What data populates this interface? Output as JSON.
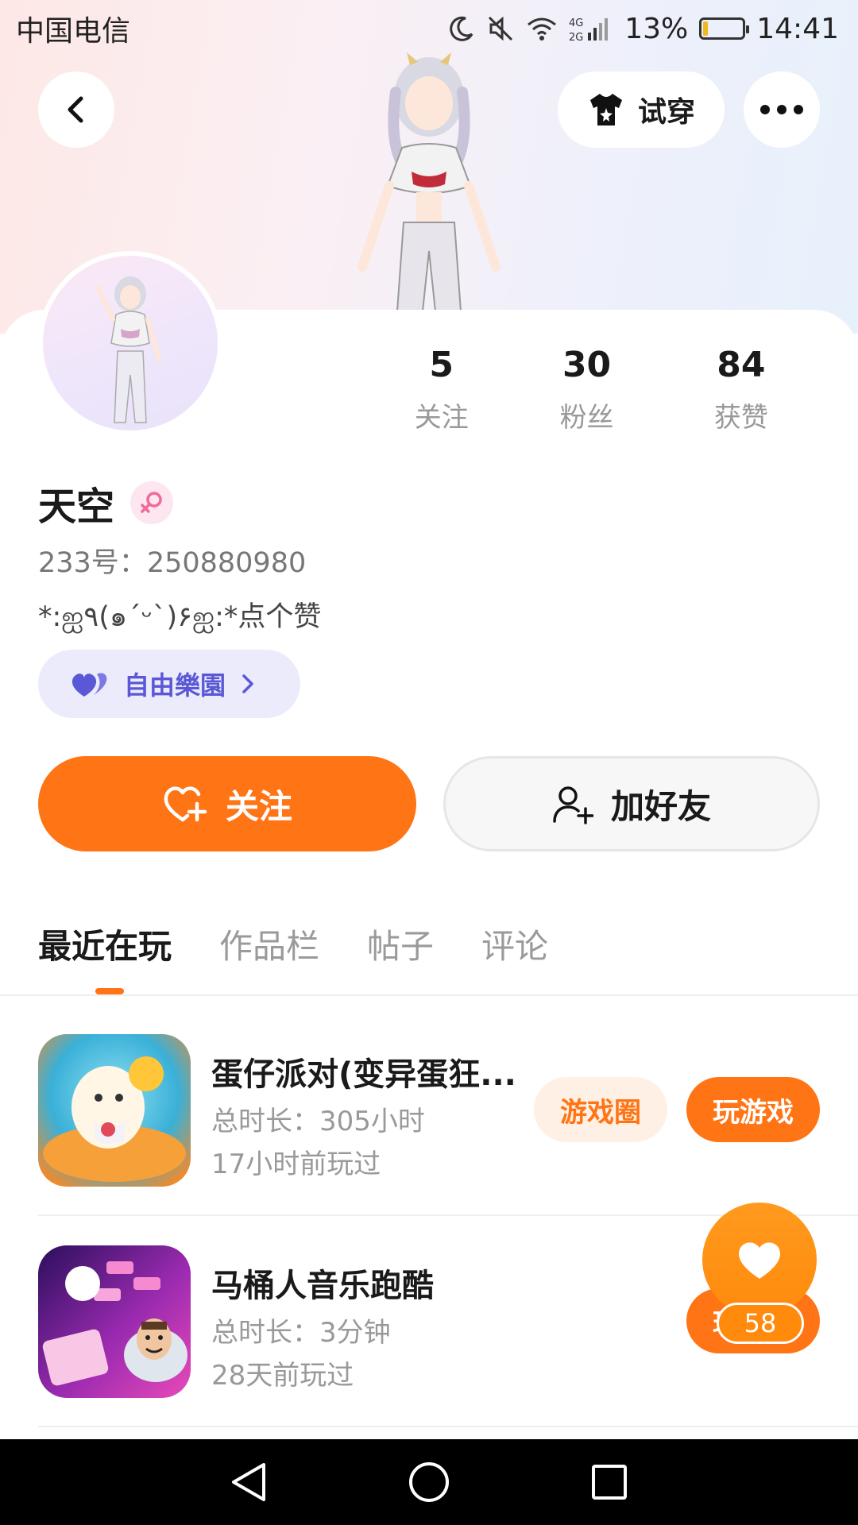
{
  "status_bar": {
    "carrier": "中国电信",
    "network": "4G 2G",
    "battery_percent": "13%",
    "battery_level": 0.13,
    "time": "14:41"
  },
  "header": {
    "back_icon": "chevron-left-icon",
    "tryon_label": "试穿",
    "tryon_icon": "shirt-icon",
    "more_icon": "ellipsis-icon"
  },
  "profile": {
    "name": "天空",
    "gender": "female",
    "uid_label": "233号：",
    "uid_value": "250880980",
    "bio": "*:ஐ٩(๑´ᵕ`)۶ஐ:*点个赞",
    "club_label": "自由樂園",
    "stats": [
      {
        "value": "5",
        "label": "关注"
      },
      {
        "value": "30",
        "label": "粉丝"
      },
      {
        "value": "84",
        "label": "获赞"
      }
    ]
  },
  "actions": {
    "follow_label": "关注",
    "add_friend_label": "加好友"
  },
  "tabs": [
    {
      "label": "最近在玩",
      "active": true
    },
    {
      "label": "作品栏",
      "active": false
    },
    {
      "label": "帖子",
      "active": false
    },
    {
      "label": "评论",
      "active": false
    }
  ],
  "games": [
    {
      "title": "蛋仔派对(变异蛋狂...",
      "duration": "总时长：305小时",
      "last_played": "17小时前玩过",
      "circle_label": "游戏圈",
      "play_label": "玩游戏"
    },
    {
      "title": "马桶人音乐跑酷",
      "duration": "总时长：3分钟",
      "last_played": "28天前玩过",
      "play_label": "玩游戏"
    }
  ],
  "fab": {
    "like_count": "58"
  },
  "colors": {
    "accent": "#ff7414",
    "club": "#5a58d6",
    "club_bg": "#ebebfb"
  }
}
